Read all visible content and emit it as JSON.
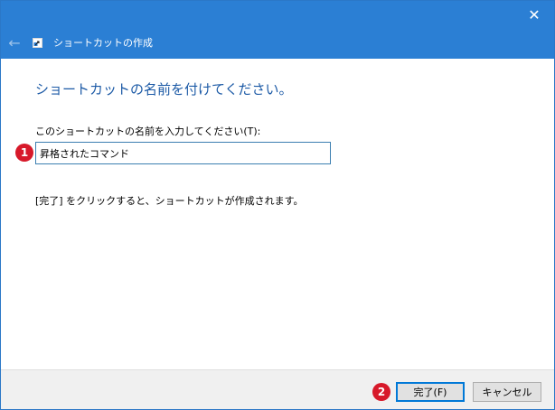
{
  "window": {
    "close_glyph": "✕"
  },
  "header": {
    "back_glyph": "←",
    "title": "ショートカットの作成",
    "icon": "shortcut-wizard-icon"
  },
  "page": {
    "instruction": "ショートカットの名前を付けてください。",
    "field_label": "このショートカットの名前を入力してください(T):",
    "name_value": "昇格されたコマンド",
    "finish_hint": "[完了] をクリックすると、ショートカットが作成されます。"
  },
  "annotations": {
    "marker_1": "1",
    "marker_2": "2",
    "marker_color": "#d7192a"
  },
  "footer": {
    "finish_label": "完了(F)",
    "cancel_label": "キャンセル"
  },
  "colors": {
    "title_bar": "#2b7fd4",
    "instruction_text": "#1c5aa6",
    "input_border": "#3c7fb1",
    "default_button_border": "#0078d7"
  }
}
